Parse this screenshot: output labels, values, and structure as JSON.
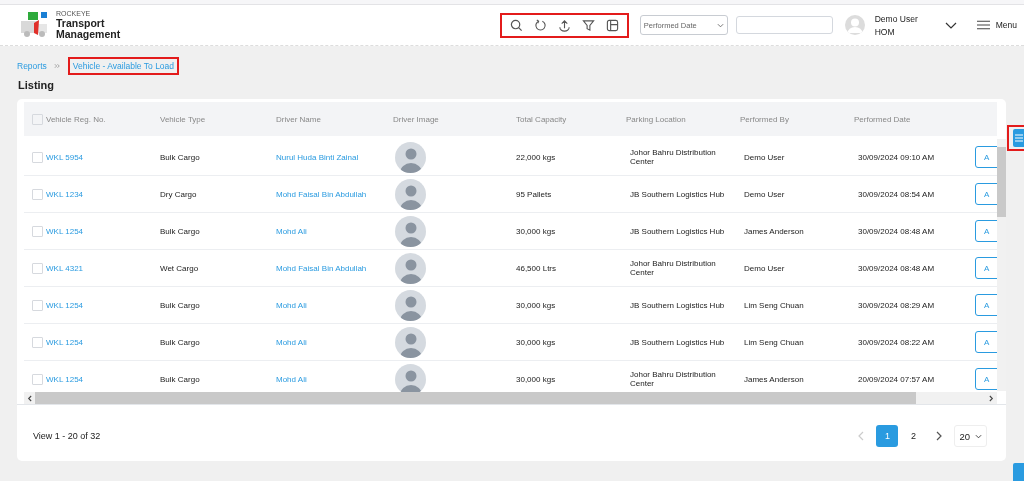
{
  "header": {
    "brand_small": "ROCKEYE",
    "brand_line1": "Transport",
    "brand_line2": "Management",
    "date_filter": {
      "value": "Performed Date"
    },
    "user": {
      "name": "Demo User",
      "role": "HOM"
    },
    "menu_label": "Menu"
  },
  "breadcrumb": [
    {
      "label": "Reports",
      "selected": false
    },
    {
      "label": "Vehicle - Available To Load",
      "selected": true
    }
  ],
  "heading": "Listing",
  "table": {
    "all_checked": false,
    "columns": [
      "Vehicle Reg. No.",
      "Vehicle Type",
      "Driver Name",
      "Driver Image",
      "Total Capacity",
      "Parking Location",
      "Performed By",
      "Performed Date"
    ],
    "rows": [
      {
        "checked": false,
        "reg": "WKL 5954",
        "type": "Bulk Cargo",
        "driver": "Nurul Huda Binti Zainal",
        "capacity": "22,000 kgs",
        "location": "Johor Bahru Distribution Center",
        "performed_by": "Demo User",
        "date": "30/09/2024 09:10 AM",
        "action": "A"
      },
      {
        "checked": false,
        "reg": "WKL 1234",
        "type": "Dry Cargo",
        "driver": "Mohd Faisal Bin Abdullah",
        "capacity": "95 Pallets",
        "location": "JB Southern Logistics Hub",
        "performed_by": "Demo User",
        "date": "30/09/2024 08:54 AM",
        "action": "A"
      },
      {
        "checked": false,
        "reg": "WKL 1254",
        "type": "Bulk Cargo",
        "driver": "Mohd Ali",
        "capacity": "30,000 kgs",
        "location": "JB Southern Logistics Hub",
        "performed_by": "James Anderson",
        "date": "30/09/2024 08:48 AM",
        "action": "A"
      },
      {
        "checked": false,
        "reg": "WKL 4321",
        "type": "Wet Cargo",
        "driver": "Mohd Faisal Bin Abdullah",
        "capacity": "46,500 Ltrs",
        "location": "Johor Bahru Distribution Center",
        "performed_by": "Demo User",
        "date": "30/09/2024 08:48 AM",
        "action": "A"
      },
      {
        "checked": false,
        "reg": "WKL 1254",
        "type": "Bulk Cargo",
        "driver": "Mohd Ali",
        "capacity": "30,000 kgs",
        "location": "JB Southern Logistics Hub",
        "performed_by": "Lim Seng Chuan",
        "date": "30/09/2024 08:29 AM",
        "action": "A"
      },
      {
        "checked": false,
        "reg": "WKL 1254",
        "type": "Bulk Cargo",
        "driver": "Mohd Ali",
        "capacity": "30,000 kgs",
        "location": "JB Southern Logistics Hub",
        "performed_by": "Lim Seng Chuan",
        "date": "30/09/2024 08:22 AM",
        "action": "A"
      },
      {
        "checked": false,
        "reg": "WKL 1254",
        "type": "Bulk Cargo",
        "driver": "Mohd Ali",
        "capacity": "30,000 kgs",
        "location": "Johor Bahru Distribution Center",
        "performed_by": "James Anderson",
        "date": "20/09/2024 07:57 AM",
        "action": "A"
      }
    ]
  },
  "pagination": {
    "summary": "View 1 - 20 of 32",
    "previous_disabled": true,
    "next_disabled": false,
    "pages": [
      {
        "label": "1",
        "selected": true
      },
      {
        "label": "2",
        "selected": false
      }
    ],
    "page_size": "20"
  }
}
